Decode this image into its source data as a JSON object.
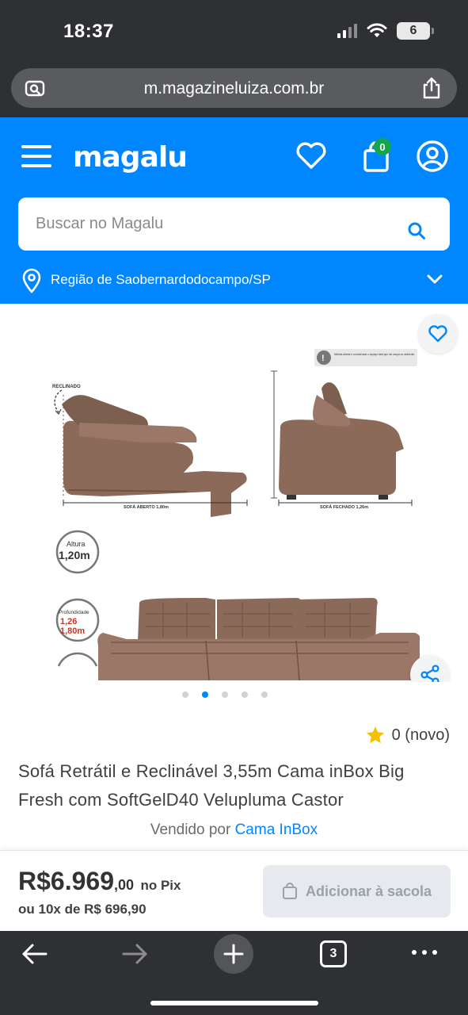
{
  "status_bar": {
    "time": "18:37",
    "battery": "6"
  },
  "browser": {
    "url": "m.magazineluiza.com.br"
  },
  "header": {
    "logo": "magalu",
    "cart_count": "0",
    "search": {
      "placeholder": "Buscar no Magalu"
    },
    "region": "Região de Saobernardodocampo/SP"
  },
  "gallery": {
    "dots_count": 5,
    "active_dot": 1,
    "image_labels": {
      "reclinado": "RECLINADO",
      "sofa_aberto": "SOFÁ ABERTO 1,80m",
      "sofa_fechado": "SOFÁ FECHADO 1,26m",
      "warning": "Medida aberta é considerada o espaço total que ele ocupa no ambiente.",
      "altura_label": "Altura",
      "altura_value": "1,20m",
      "profundidade_label": "Profundidade",
      "profundidade_fechado": "1,26",
      "profundidade_aberto": "1,80m"
    }
  },
  "product": {
    "rating": "0 (novo)",
    "title": "Sofá Retrátil e Reclinável 3,55m Cama inBox Big Fresh com SoftGelD40 Velupluma Castor",
    "seller_prefix": "Vendido por",
    "seller_name": "Cama InBox"
  },
  "buy_bar": {
    "price_main": "R$6.969",
    "price_cents": ",00",
    "price_suffix": "no Pix",
    "installments": "ou 10x de R$ 696,90",
    "add_button": "Adicionar à sacola"
  },
  "toolbar": {
    "tabs_count": "3"
  },
  "colors": {
    "brand_blue": "#0086ff",
    "badge_green": "#17a54a",
    "star": "#f2c200"
  }
}
